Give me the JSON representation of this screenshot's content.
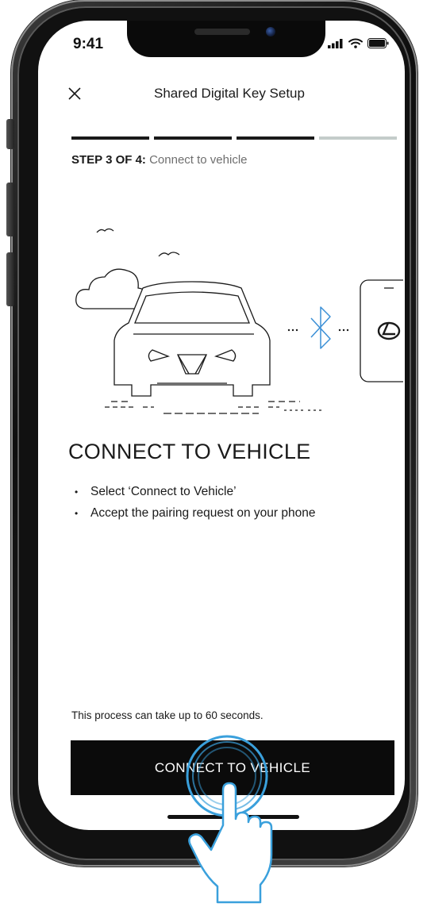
{
  "status_bar": {
    "time": "9:41",
    "icons": [
      "cellular-signal-icon",
      "wifi-icon",
      "battery-icon"
    ]
  },
  "nav": {
    "close_icon": "close-icon",
    "title": "Shared Digital Key Setup"
  },
  "progress": {
    "total_steps": 4,
    "current_step": 3
  },
  "step": {
    "label": "STEP 3 OF 4:",
    "name": "Connect to vehicle"
  },
  "illustration": {
    "icons": [
      "car-icon",
      "cloud-icon",
      "bird-icon",
      "bluetooth-icon",
      "phone-icon",
      "lexus-logo-icon"
    ],
    "colors": {
      "bluetooth": "#3a8fd6",
      "line": "#1a1a1a"
    }
  },
  "content": {
    "heading": "CONNECT TO VEHICLE",
    "bullets": [
      "Select ‘Connect to Vehicle’",
      "Accept the pairing request on your phone"
    ],
    "note": "This process can take up to 60 seconds."
  },
  "cta": {
    "label": "CONNECT TO VEHICLE"
  },
  "overlay": {
    "icons": [
      "tap-hand-icon",
      "touch-ripple-icon"
    ],
    "colors": {
      "ripple": "#3aa0dc"
    }
  },
  "colors": {
    "primary": "#0b0b0b",
    "progress_done": "#1a1a1a",
    "progress_pending": "#c4ccca",
    "muted_text": "#6e6e6e"
  }
}
